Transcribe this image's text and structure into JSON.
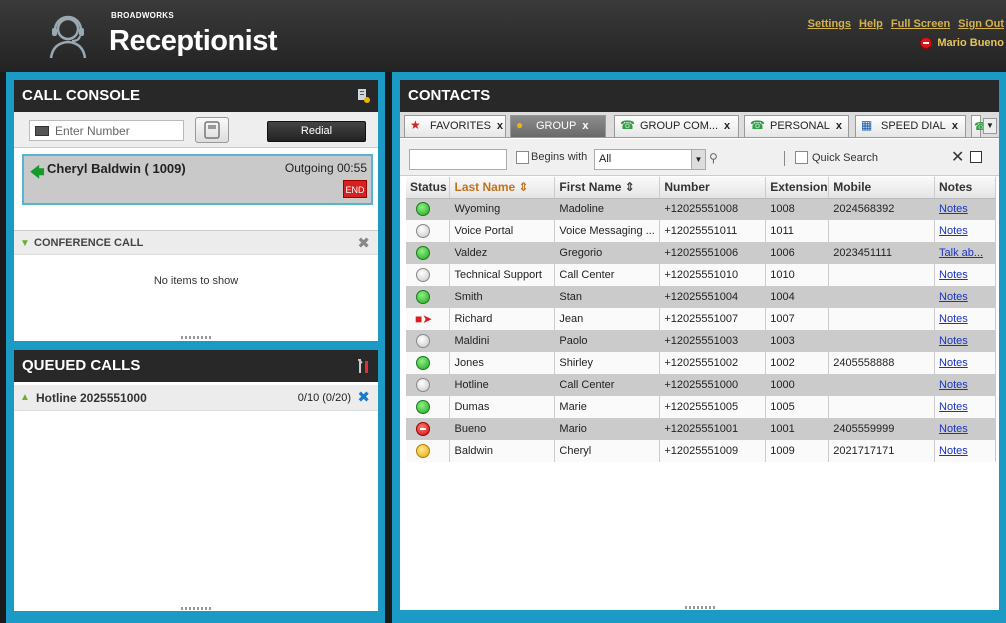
{
  "app": {
    "brand_small": "BROADWORKS",
    "brand_title": "Receptionist"
  },
  "header": {
    "links": [
      "Settings",
      "Help",
      "Full Screen",
      "Sign Out"
    ],
    "user_name": "Mario Bueno",
    "user_status_color": "#d81818"
  },
  "call_console": {
    "title": "CALL CONSOLE",
    "input_placeholder": "Enter Number",
    "redial_label": "Redial",
    "active_call": {
      "name": "Cheryl Baldwin ( 1009)",
      "status": "Outgoing 00:55",
      "end_label": "END"
    },
    "conference": {
      "title": "CONFERENCE CALL",
      "empty_text": "No items to show"
    }
  },
  "queued_calls": {
    "title": "QUEUED CALLS",
    "queue_name": "Hotline 2025551000",
    "queue_count": "0/10 (0/20)"
  },
  "contacts": {
    "title": "CONTACTS",
    "tabs": [
      {
        "label": "FAVORITES",
        "close": "x",
        "active": false
      },
      {
        "label": "GROUP",
        "close": "x",
        "active": true
      },
      {
        "label": "GROUP COM...",
        "close": "x",
        "active": false
      },
      {
        "label": "PERSONAL",
        "close": "x",
        "active": false
      },
      {
        "label": "SPEED DIAL",
        "close": "x",
        "active": false
      }
    ],
    "filter": {
      "search_value": "",
      "begins_with_label": "Begins with",
      "begins_with_selected": "All",
      "quick_search_label": "Quick Search"
    },
    "columns": [
      "Status",
      "Last Name",
      "First Name",
      "Number",
      "Extension",
      "Mobile",
      "Notes"
    ],
    "rows": [
      {
        "status": "available",
        "last": "Wyoming",
        "first": "Madoline",
        "number": "+12025551008",
        "ext": "1008",
        "mobile": "2024568392",
        "notes": "Notes"
      },
      {
        "status": "unknown",
        "last": "Voice Portal",
        "first": "Voice Messaging ...",
        "number": "+12025551011",
        "ext": "1011",
        "mobile": "",
        "notes": "Notes"
      },
      {
        "status": "available",
        "last": "Valdez",
        "first": "Gregorio",
        "number": "+12025551006",
        "ext": "1006",
        "mobile": "2023451111",
        "notes": "Talk ab..."
      },
      {
        "status": "unknown",
        "last": "Technical Support",
        "first": "Call Center",
        "number": "+12025551010",
        "ext": "1010",
        "mobile": "",
        "notes": "Notes"
      },
      {
        "status": "available",
        "last": "Smith",
        "first": "Stan",
        "number": "+12025551004",
        "ext": "1004",
        "mobile": "",
        "notes": "Notes"
      },
      {
        "status": "ringing",
        "last": "Richard",
        "first": "Jean",
        "number": "+12025551007",
        "ext": "1007",
        "mobile": "",
        "notes": "Notes"
      },
      {
        "status": "unknown",
        "last": "Maldini",
        "first": "Paolo",
        "number": "+12025551003",
        "ext": "1003",
        "mobile": "",
        "notes": "Notes"
      },
      {
        "status": "available",
        "last": "Jones",
        "first": "Shirley",
        "number": "+12025551002",
        "ext": "1002",
        "mobile": "2405558888",
        "notes": "Notes"
      },
      {
        "status": "unknown",
        "last": "Hotline",
        "first": "Call Center",
        "number": "+12025551000",
        "ext": "1000",
        "mobile": "",
        "notes": "Notes"
      },
      {
        "status": "available",
        "last": "Dumas",
        "first": "Marie",
        "number": "+12025551005",
        "ext": "1005",
        "mobile": "",
        "notes": "Notes"
      },
      {
        "status": "busy",
        "last": "Bueno",
        "first": "Mario",
        "number": "+12025551001",
        "ext": "1001",
        "mobile": "2405559999",
        "notes": "Notes"
      },
      {
        "status": "away",
        "last": "Baldwin",
        "first": "Cheryl",
        "number": "+12025551009",
        "ext": "1009",
        "mobile": "2021717171",
        "notes": "Notes"
      }
    ]
  },
  "colors": {
    "accent": "#1a9ac5",
    "header_bg": "#282828",
    "link_gold": "#d4b24c"
  }
}
